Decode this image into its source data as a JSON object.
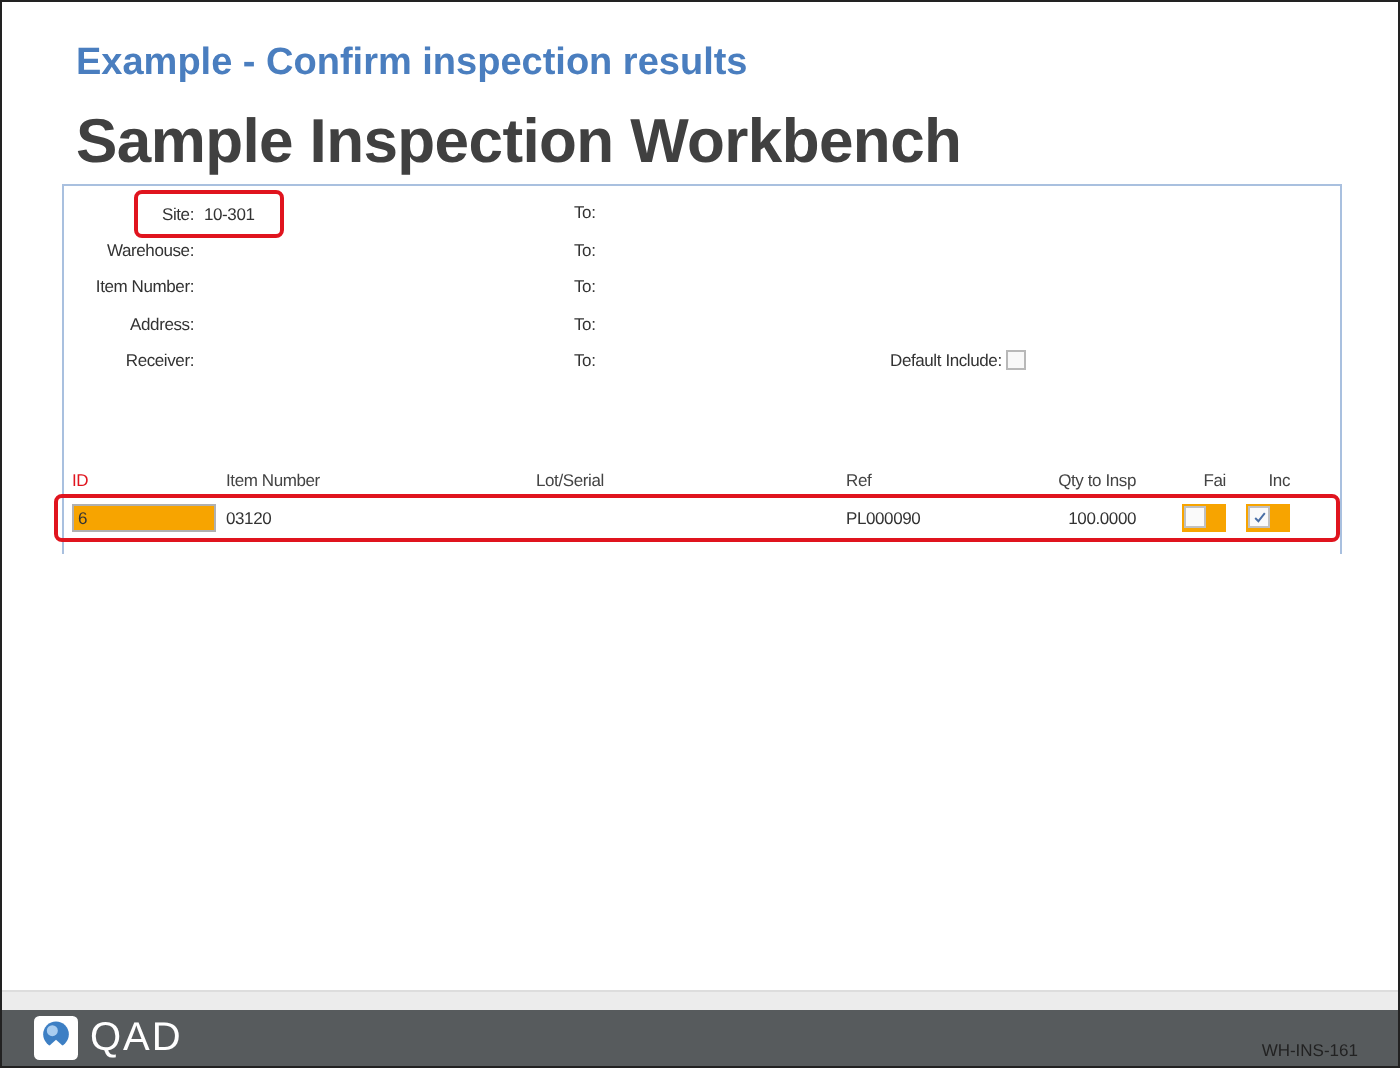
{
  "slide": {
    "subtitle": "Example - Confirm inspection results",
    "title": "Sample Inspection Workbench"
  },
  "filters": [
    {
      "label": "Site:",
      "value": "10-301",
      "to": "To:",
      "highlighted": true
    },
    {
      "label": "Warehouse:",
      "to": "To:",
      "highlighted": false
    },
    {
      "label": "Item Number:",
      "to": "To:",
      "highlighted": false
    },
    {
      "label": "Address:",
      "to": "To:",
      "highlighted": false
    },
    {
      "label": "Receiver:",
      "to": "To:",
      "highlighted": false
    }
  ],
  "default_include": {
    "label": "Default Include:",
    "checked": false
  },
  "table": {
    "columns": [
      {
        "label": "ID",
        "required": true
      },
      {
        "label": "Item Number",
        "required": false
      },
      {
        "label": "Lot/Serial",
        "required": false
      },
      {
        "label": "Ref",
        "required": false
      },
      {
        "label": "Qty to Insp",
        "required": false
      },
      {
        "label": "Fai",
        "required": false
      },
      {
        "label": "Inc",
        "required": false
      }
    ],
    "rows": [
      {
        "id": "6",
        "item_number": "03120",
        "ref": "PL000090",
        "qty": "100.0000",
        "fai": false,
        "inc": true,
        "highlighted": true
      }
    ]
  },
  "footer": {
    "logo": "QAD",
    "code": "WH-INS-161"
  }
}
